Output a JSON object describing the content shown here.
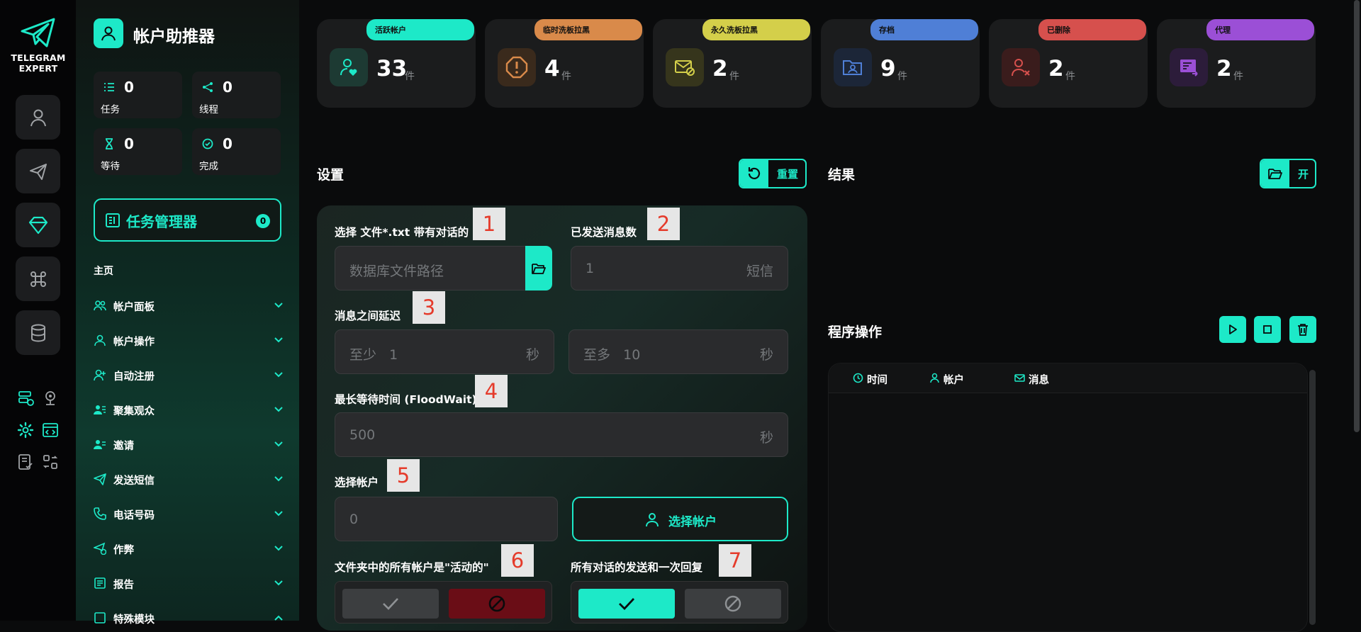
{
  "brand": {
    "line1": "TELEGRAM",
    "line2": "EXPERT"
  },
  "sidebar": {
    "title": "帐户助推器",
    "stats": [
      {
        "value": "0",
        "label": "任务",
        "icon": "list-icon"
      },
      {
        "value": "0",
        "label": "线程",
        "icon": "share-nodes-icon"
      },
      {
        "value": "0",
        "label": "等待",
        "icon": "hourglass-icon"
      },
      {
        "value": "0",
        "label": "完成",
        "icon": "check-circle-icon"
      }
    ],
    "task_manager": {
      "label": "任务管理器",
      "count": "0"
    },
    "nav_heading": "主页",
    "nav_items": [
      {
        "label": "帐户面板",
        "icon": "users-icon"
      },
      {
        "label": "帐户操作",
        "icon": "user-icon"
      },
      {
        "label": "自动注册",
        "icon": "user-plus-icon"
      },
      {
        "label": "聚集观众",
        "icon": "user-group-icon"
      },
      {
        "label": "邀请",
        "icon": "user-list-icon"
      },
      {
        "label": "发送短信",
        "icon": "paper-plane-icon"
      },
      {
        "label": "电话号码",
        "icon": "phone-icon"
      },
      {
        "label": "作弊",
        "icon": "send-check-icon"
      },
      {
        "label": "报告",
        "icon": "report-icon"
      },
      {
        "label": "特殊模块",
        "icon": "module-icon"
      }
    ]
  },
  "status_cards": [
    {
      "tag": "活跃帐户",
      "value": "33",
      "unit": "件",
      "color": "#1de9c8",
      "icon": "user-heart-icon"
    },
    {
      "tag": "临时洗板拉黑",
      "value": "4",
      "unit": "件",
      "color": "#d98a4a",
      "icon": "warning-octagon-icon"
    },
    {
      "tag": "永久洗板拉黑",
      "value": "2",
      "unit": "件",
      "color": "#d4cf4a",
      "icon": "mail-blocked-icon"
    },
    {
      "tag": "存档",
      "value": "9",
      "unit": "件",
      "color": "#4f7fd6",
      "icon": "folder-user-icon"
    },
    {
      "tag": "已删除",
      "value": "2",
      "unit": "件",
      "color": "#d6504d",
      "icon": "user-x-icon"
    },
    {
      "tag": "代理",
      "value": "2",
      "unit": "件",
      "color": "#9b4fd6",
      "icon": "proxy-icon"
    }
  ],
  "settings": {
    "title": "设置",
    "reset_label": "重置",
    "file_label": "选择 文件*.txt 带有对话的",
    "file_placeholder": "数据库文件路径",
    "sent_count_label": "已发送消息数",
    "sent_count_placeholder": "1",
    "sent_count_suffix": "短信",
    "delay_label": "消息之间延迟",
    "delay_min_prefix": "至少",
    "delay_min_value": "1",
    "delay_max_prefix": "至多",
    "delay_max_value": "10",
    "seconds": "秒",
    "floodwait_label": "最长等待时间 (FloodWait)",
    "floodwait_placeholder": "500",
    "account_label": "选择帐户",
    "account_value": "0",
    "select_account_btn": "选择帐户",
    "active_label": "文件夹中的所有帐户是\"活动的\"",
    "reply_label": "所有对话的发送和一次回复",
    "markers": [
      "1",
      "2",
      "3",
      "4",
      "5",
      "6",
      "7"
    ]
  },
  "results": {
    "title": "结果",
    "open_label": "开",
    "ops_title": "程序操作",
    "columns": [
      "时间",
      "帐户",
      "消息"
    ]
  }
}
